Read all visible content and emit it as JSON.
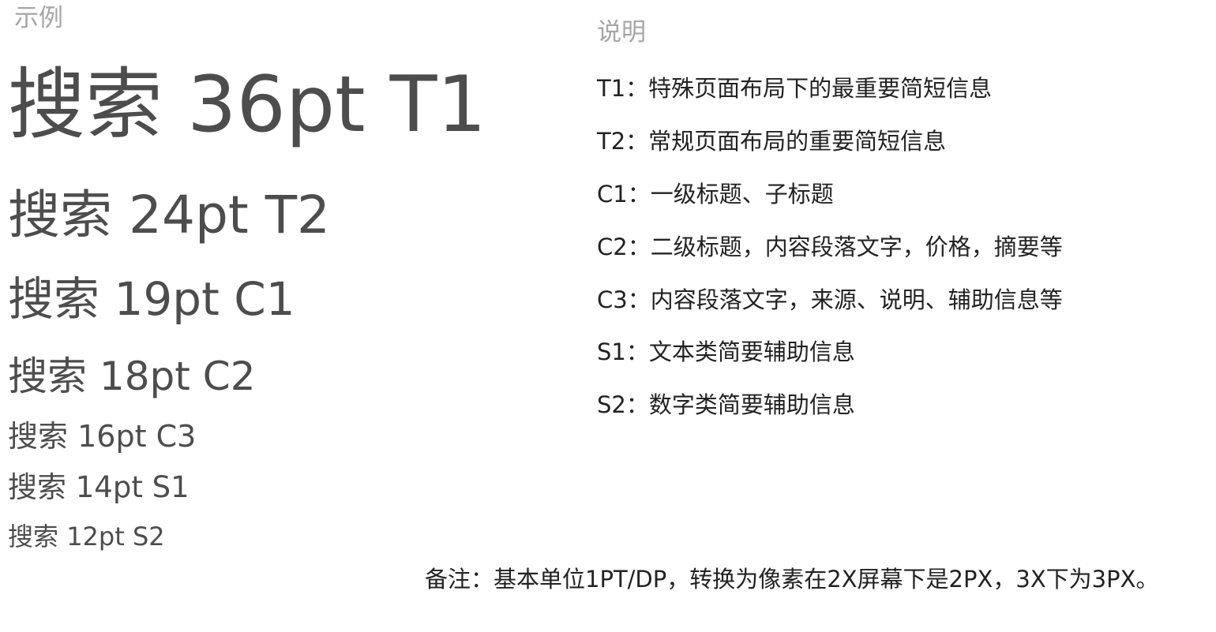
{
  "left_label": "示例",
  "right_label": "说明",
  "samples": [
    {
      "word": "搜索",
      "size": "36pt",
      "code": "T1"
    },
    {
      "word": "搜索",
      "size": "24pt",
      "code": "T2"
    },
    {
      "word": "搜索",
      "size": "19pt",
      "code": "C1"
    },
    {
      "word": "搜索",
      "size": "18pt",
      "code": "C2"
    },
    {
      "word": "搜索",
      "size": "16pt",
      "code": "C3"
    },
    {
      "word": "搜索",
      "size": "14pt",
      "code": "S1"
    },
    {
      "word": "搜索",
      "size": "12pt",
      "code": "S2"
    }
  ],
  "descriptions": [
    "T1：特殊页面布局下的最重要简短信息",
    "T2：常规页面布局的重要简短信息",
    "C1：一级标题、子标题",
    "C2：二级标题，内容段落文字，价格，摘要等",
    "C3：内容段落文字，来源、说明、辅助信息等",
    "S1：文本类简要辅助信息",
    "S2：数字类简要辅助信息"
  ],
  "footnote": "备注：基本单位1PT/DP，转换为像素在2X屏幕下是2PX，3X下为3PX。"
}
